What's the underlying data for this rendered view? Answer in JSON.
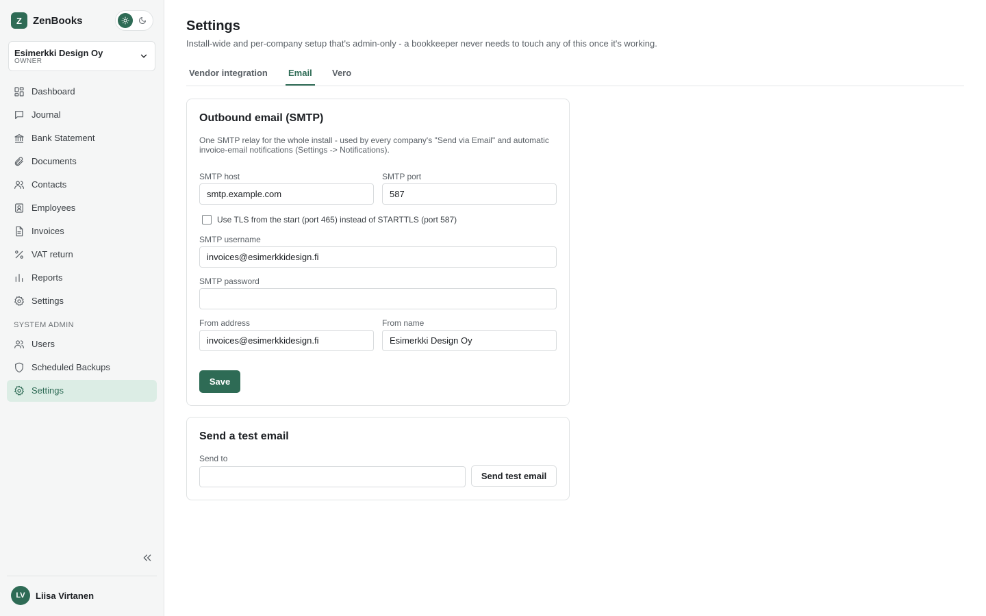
{
  "app": {
    "name": "ZenBooks",
    "logo_letter": "Z"
  },
  "theme": {
    "light_icon": "sun-icon",
    "dark_icon": "moon-icon"
  },
  "company": {
    "name": "Esimerkki Design Oy",
    "role": "OWNER"
  },
  "sidebar": {
    "items": [
      {
        "label": "Dashboard",
        "icon": "dashboard-icon"
      },
      {
        "label": "Journal",
        "icon": "journal-icon"
      },
      {
        "label": "Bank Statement",
        "icon": "bank-icon"
      },
      {
        "label": "Documents",
        "icon": "paperclip-icon"
      },
      {
        "label": "Contacts",
        "icon": "contacts-icon"
      },
      {
        "label": "Employees",
        "icon": "employee-badge-icon"
      },
      {
        "label": "Invoices",
        "icon": "invoice-icon"
      },
      {
        "label": "VAT return",
        "icon": "percent-icon"
      },
      {
        "label": "Reports",
        "icon": "bar-chart-icon"
      },
      {
        "label": "Settings",
        "icon": "gear-icon"
      }
    ],
    "admin_section_label": "SYSTEM ADMIN",
    "admin_items": [
      {
        "label": "Users",
        "icon": "users-icon"
      },
      {
        "label": "Scheduled Backups",
        "icon": "shield-icon"
      },
      {
        "label": "Settings",
        "icon": "gear-icon",
        "active": true
      }
    ]
  },
  "user": {
    "initials": "LV",
    "name": "Liisa Virtanen"
  },
  "page": {
    "title": "Settings",
    "subtitle": "Install-wide and per-company setup that's admin-only - a bookkeeper never needs to touch any of this once it's working.",
    "tabs": [
      {
        "label": "Vendor integration",
        "active": false
      },
      {
        "label": "Email",
        "active": true
      },
      {
        "label": "Vero",
        "active": false
      }
    ]
  },
  "smtp": {
    "title": "Outbound email (SMTP)",
    "description": "One SMTP relay for the whole install - used by every company's \"Send via Email\" and automatic invoice-email notifications (Settings -> Notifications).",
    "host_label": "SMTP host",
    "host_value": "smtp.example.com",
    "port_label": "SMTP port",
    "port_value": "587",
    "tls_label": "Use TLS from the start (port 465) instead of STARTTLS (port 587)",
    "tls_checked": false,
    "username_label": "SMTP username",
    "username_value": "invoices@esimerkkidesign.fi",
    "password_label": "SMTP password",
    "password_value": "",
    "from_address_label": "From address",
    "from_address_value": "invoices@esimerkkidesign.fi",
    "from_name_label": "From name",
    "from_name_value": "Esimerkki Design Oy",
    "save_label": "Save"
  },
  "test_email": {
    "title": "Send a test email",
    "send_to_label": "Send to",
    "send_to_value": "",
    "button_label": "Send test email"
  },
  "colors": {
    "accent": "#2e6b55",
    "active_bg": "#dcede5",
    "sidebar_bg": "#f5f6f6"
  }
}
